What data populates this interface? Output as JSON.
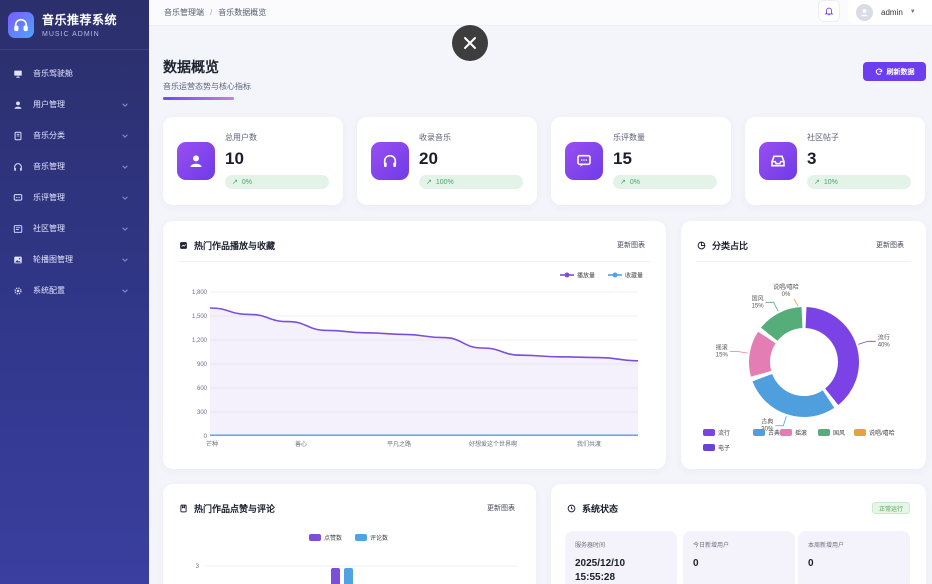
{
  "brand": {
    "title": "音乐推荐系统",
    "subtitle": "MUSIC ADMIN"
  },
  "sidebar": {
    "items": [
      {
        "label": "音乐驾驶舱",
        "icon": "monitor-icon",
        "has_children": false
      },
      {
        "label": "用户管理",
        "icon": "user-icon",
        "has_children": true
      },
      {
        "label": "音乐分类",
        "icon": "book-icon",
        "has_children": true
      },
      {
        "label": "音乐管理",
        "icon": "headphones-icon",
        "has_children": true
      },
      {
        "label": "乐评管理",
        "icon": "comment-icon",
        "has_children": true
      },
      {
        "label": "社区管理",
        "icon": "community-icon",
        "has_children": true
      },
      {
        "label": "轮播图管理",
        "icon": "image-icon",
        "has_children": true
      },
      {
        "label": "系统配置",
        "icon": "gear-icon",
        "has_children": true
      }
    ]
  },
  "header": {
    "breadcrumb": [
      "音乐管理端",
      "音乐数据概览"
    ],
    "user": "admin"
  },
  "page": {
    "title": "数据概览",
    "subtitle": "音乐运营态势与核心指标",
    "refresh_label": "刷新数据"
  },
  "stats": [
    {
      "label": "总用户数",
      "value": "10",
      "trend": "0%",
      "icon": "user-icon"
    },
    {
      "label": "收录音乐",
      "value": "20",
      "trend": "100%",
      "icon": "headphones-icon"
    },
    {
      "label": "乐评数量",
      "value": "15",
      "trend": "0%",
      "icon": "comment-icon"
    },
    {
      "label": "社区帖子",
      "value": "3",
      "trend": "10%",
      "icon": "inbox-icon"
    }
  ],
  "line_card": {
    "title": "热门作品播放与收藏",
    "link": "更新图表"
  },
  "pie_card": {
    "title": "分类占比",
    "link": "更新图表"
  },
  "bar_card": {
    "title": "热门作品点赞与评论",
    "link": "更新图表"
  },
  "system_card": {
    "title": "系统状态",
    "status": "正常运行",
    "boxes": [
      {
        "label": "服务器时间",
        "value": "2025/12/10\n15:55:28"
      },
      {
        "label": "今日新增用户",
        "value": "0"
      },
      {
        "label": "本周新增用户",
        "value": "0"
      }
    ]
  },
  "chart_data": [
    {
      "type": "line",
      "title": "热门作品播放与收藏",
      "x_tick_labels": [
        "芒种",
        "善心",
        "平凡之路",
        "好想爱这个世界啊",
        "我们共渡"
      ],
      "y_ticks": [
        0,
        300,
        600,
        900,
        1200,
        1500,
        1800
      ],
      "ylim": [
        0,
        1800
      ],
      "legend_position": "top-right",
      "grid": true,
      "series": [
        {
          "name": "播放量",
          "color": "#7b4fd9",
          "values": [
            1600,
            1520,
            1430,
            1320,
            1290,
            1270,
            1230,
            1100,
            1010,
            990,
            980,
            940
          ]
        },
        {
          "name": "收藏量",
          "color": "#4fa3e0",
          "values": [
            10,
            10,
            10,
            10,
            10,
            10,
            10,
            10,
            10,
            10,
            10,
            10
          ]
        }
      ]
    },
    {
      "type": "pie",
      "title": "分类占比",
      "legend_position": "bottom",
      "slices": [
        {
          "name": "流行",
          "label": "流行\n40%",
          "value": 40,
          "color": "#7b43e6"
        },
        {
          "name": "古典",
          "label": "古典\n30%",
          "value": 30,
          "color": "#4f9fdf"
        },
        {
          "name": "摇滚",
          "label": "摇滚\n15%",
          "value": 15,
          "color": "#e37db3"
        },
        {
          "name": "国风",
          "label": "国风\n15%",
          "value": 15,
          "color": "#55ad7a"
        },
        {
          "name": "说唱/嘻哈",
          "label": "说唱/嘻哈\n0%",
          "value": 0,
          "color": "#e5a33c"
        },
        {
          "name": "电子",
          "label": "",
          "value": 0,
          "color": "#6a42d6"
        }
      ]
    },
    {
      "type": "bar",
      "title": "热门作品点赞与评论",
      "legend_position": "top",
      "y_tick_visible": "3",
      "series": [
        {
          "name": "点赞数",
          "color": "#7b4fd9"
        },
        {
          "name": "评论数",
          "color": "#4fa3e0"
        }
      ]
    }
  ]
}
